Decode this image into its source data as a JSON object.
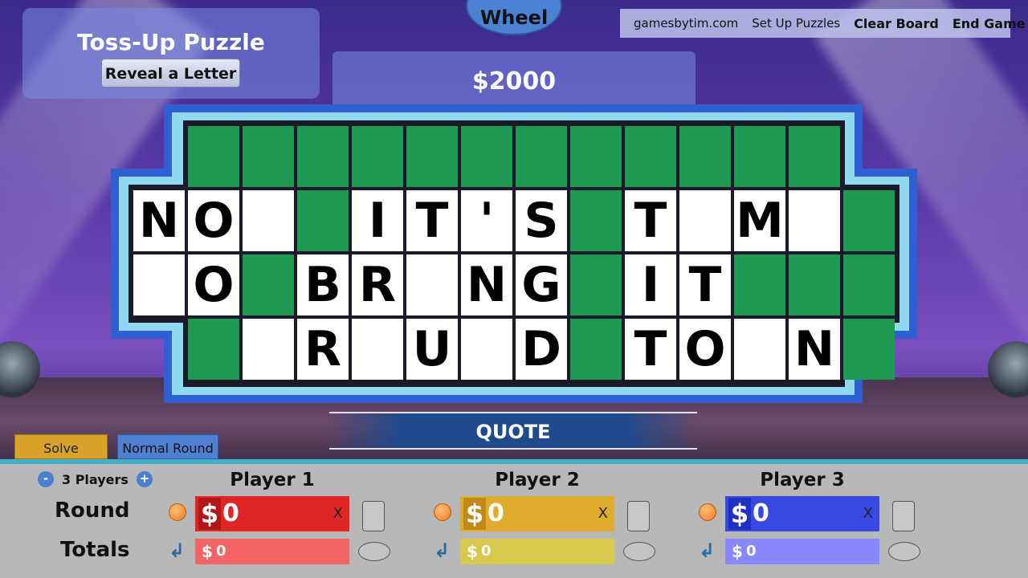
{
  "tossup": {
    "title": "Toss-Up Puzzle",
    "reveal_label": "Reveal a Letter"
  },
  "wheel_label": "Wheel",
  "value": "$2000",
  "menu": {
    "site": "gamesbytim.com",
    "setup": "Set Up Puzzles",
    "clear": "Clear Board",
    "end": "End Game"
  },
  "board": {
    "rows": [
      [
        "#",
        "#",
        "#",
        "#",
        "#",
        "#",
        "#",
        "#",
        "#",
        "#",
        "#",
        "#"
      ],
      [
        "N",
        "O",
        " ",
        "#",
        "I",
        "T",
        "'",
        "S",
        "#",
        "T",
        " ",
        "M",
        " ",
        "#"
      ],
      [
        " ",
        "O",
        "#",
        "B",
        "R",
        " ",
        "N",
        "G",
        "#",
        "I",
        "T",
        "#",
        "#",
        "#"
      ],
      [
        "#",
        " ",
        "R",
        " ",
        "U",
        " ",
        "D",
        "#",
        "T",
        "O",
        " ",
        "N",
        "#"
      ]
    ]
  },
  "category": "QUOTE",
  "solve_label": "Solve",
  "round_label": "Normal Round",
  "players_count": {
    "minus": "-",
    "label": "3 Players",
    "plus": "+"
  },
  "rows": {
    "round": "Round",
    "totals": "Totals"
  },
  "players": [
    {
      "name": "Player 1",
      "round": "0",
      "total": "0",
      "dollar": "$",
      "x": "X",
      "round_color": "#e02525",
      "dollar_bg": "#b01818",
      "total_color": "#f46464"
    },
    {
      "name": "Player 2",
      "round": "0",
      "total": "0",
      "dollar": "$",
      "x": "X",
      "round_color": "#e0ac2e",
      "dollar_bg": "#c08a1a",
      "total_color": "#d8c94c"
    },
    {
      "name": "Player 3",
      "round": "0",
      "total": "0",
      "dollar": "$",
      "x": "X",
      "round_color": "#3848e0",
      "dollar_bg": "#2030c0",
      "total_color": "#8888ff"
    }
  ]
}
